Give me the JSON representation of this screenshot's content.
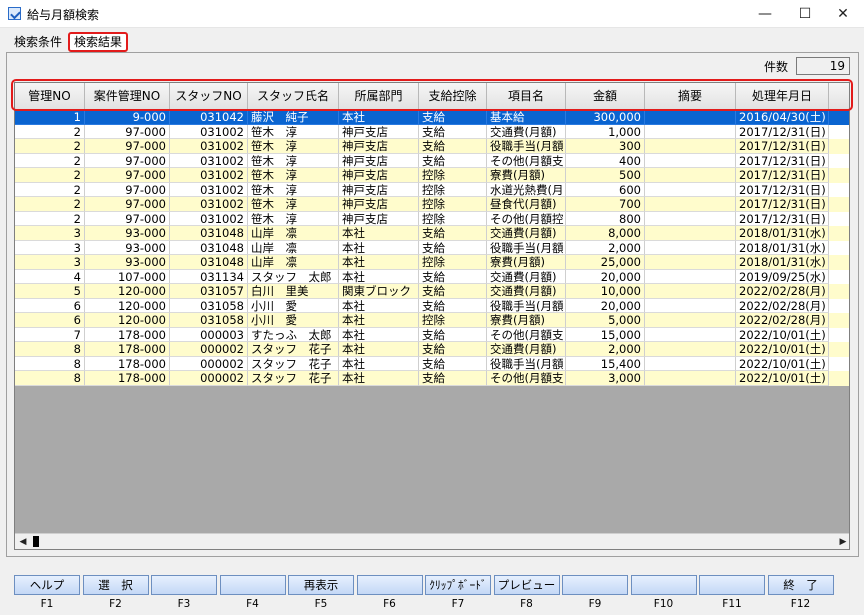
{
  "window": {
    "title": "給与月額検索",
    "min_glyph": "—",
    "max_glyph": "☐",
    "close_glyph": "✕"
  },
  "tabs": [
    {
      "label": "検索条件"
    },
    {
      "label": "検索結果"
    }
  ],
  "count": {
    "label": "件数",
    "value": "19"
  },
  "columns": [
    "管理NO",
    "案件管理NO",
    "スタッフNO",
    "スタッフ氏名",
    "所属部門",
    "支給控除",
    "項目名",
    "金額",
    "摘要",
    "処理年月日"
  ],
  "rows": [
    [
      "1",
      "9-000",
      "031042",
      "藤沢　純子",
      "本社",
      "支給",
      "基本給",
      "300,000",
      "",
      "2016/04/30(土)"
    ],
    [
      "2",
      "97-000",
      "031002",
      "笹木　淳",
      "神戸支店",
      "支給",
      "交通費(月額)",
      "1,000",
      "",
      "2017/12/31(日)"
    ],
    [
      "2",
      "97-000",
      "031002",
      "笹木　淳",
      "神戸支店",
      "支給",
      "役職手当(月額",
      "300",
      "",
      "2017/12/31(日)"
    ],
    [
      "2",
      "97-000",
      "031002",
      "笹木　淳",
      "神戸支店",
      "支給",
      "その他(月額支",
      "400",
      "",
      "2017/12/31(日)"
    ],
    [
      "2",
      "97-000",
      "031002",
      "笹木　淳",
      "神戸支店",
      "控除",
      "寮費(月額)",
      "500",
      "",
      "2017/12/31(日)"
    ],
    [
      "2",
      "97-000",
      "031002",
      "笹木　淳",
      "神戸支店",
      "控除",
      "水道光熱費(月",
      "600",
      "",
      "2017/12/31(日)"
    ],
    [
      "2",
      "97-000",
      "031002",
      "笹木　淳",
      "神戸支店",
      "控除",
      "昼食代(月額)",
      "700",
      "",
      "2017/12/31(日)"
    ],
    [
      "2",
      "97-000",
      "031002",
      "笹木　淳",
      "神戸支店",
      "控除",
      "その他(月額控",
      "800",
      "",
      "2017/12/31(日)"
    ],
    [
      "3",
      "93-000",
      "031048",
      "山岸　凛",
      "本社",
      "支給",
      "交通費(月額)",
      "8,000",
      "",
      "2018/01/31(水)"
    ],
    [
      "3",
      "93-000",
      "031048",
      "山岸　凛",
      "本社",
      "支給",
      "役職手当(月額",
      "2,000",
      "",
      "2018/01/31(水)"
    ],
    [
      "3",
      "93-000",
      "031048",
      "山岸　凛",
      "本社",
      "控除",
      "寮費(月額)",
      "25,000",
      "",
      "2018/01/31(水)"
    ],
    [
      "4",
      "107-000",
      "031134",
      "スタッフ　太郎",
      "本社",
      "支給",
      "交通費(月額)",
      "20,000",
      "",
      "2019/09/25(水)"
    ],
    [
      "5",
      "120-000",
      "031057",
      "白川　里美",
      "関東ブロック",
      "支給",
      "交通費(月額)",
      "10,000",
      "",
      "2022/02/28(月)"
    ],
    [
      "6",
      "120-000",
      "031058",
      "小川　愛",
      "本社",
      "支給",
      "役職手当(月額",
      "20,000",
      "",
      "2022/02/28(月)"
    ],
    [
      "6",
      "120-000",
      "031058",
      "小川　愛",
      "本社",
      "控除",
      "寮費(月額)",
      "5,000",
      "",
      "2022/02/28(月)"
    ],
    [
      "7",
      "178-000",
      "000003",
      "すたっふ　太郎",
      "本社",
      "支給",
      "その他(月額支",
      "15,000",
      "",
      "2022/10/01(土)"
    ],
    [
      "8",
      "178-000",
      "000002",
      "スタッフ　花子",
      "本社",
      "支給",
      "交通費(月額)",
      "2,000",
      "",
      "2022/10/01(土)"
    ],
    [
      "8",
      "178-000",
      "000002",
      "スタッフ　花子",
      "本社",
      "支給",
      "役職手当(月額",
      "15,400",
      "",
      "2022/10/01(土)"
    ],
    [
      "8",
      "178-000",
      "000002",
      "スタッフ　花子",
      "本社",
      "支給",
      "その他(月額支",
      "3,000",
      "",
      "2022/10/01(土)"
    ]
  ],
  "scrollbar": {
    "left_glyph": "◀",
    "right_glyph": "▶"
  },
  "function_keys": [
    {
      "key": "F1",
      "label": "ヘルプ"
    },
    {
      "key": "F2",
      "label": "選　択"
    },
    {
      "key": "F3",
      "label": ""
    },
    {
      "key": "F4",
      "label": ""
    },
    {
      "key": "F5",
      "label": "再表示"
    },
    {
      "key": "F6",
      "label": ""
    },
    {
      "key": "F7",
      "label": "ｸﾘｯﾌﾟﾎﾞｰﾄﾞ"
    },
    {
      "key": "F8",
      "label": "プレビュー"
    },
    {
      "key": "F9",
      "label": ""
    },
    {
      "key": "F10",
      "label": ""
    },
    {
      "key": "F11",
      "label": ""
    },
    {
      "key": "F12",
      "label": "終　了"
    }
  ],
  "colors": {
    "selected_row": "#0a64d0",
    "alt_row": "#fffccc",
    "highlight_border": "#e21b1b"
  }
}
